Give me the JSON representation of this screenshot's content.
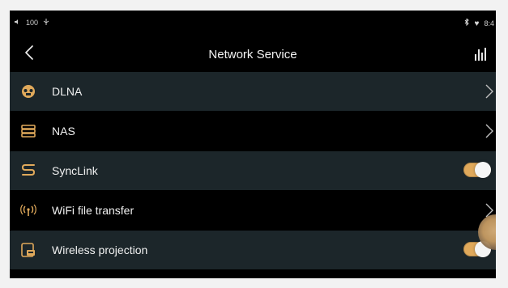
{
  "status": {
    "battery": "100",
    "time": "8:4"
  },
  "header": {
    "title": "Network Service"
  },
  "items": [
    {
      "label": "DLNA",
      "icon": "dlna-icon",
      "action": "chevron"
    },
    {
      "label": "NAS",
      "icon": "nas-icon",
      "action": "chevron"
    },
    {
      "label": "SyncLink",
      "icon": "synclink-icon",
      "action": "toggle",
      "on": true
    },
    {
      "label": "WiFi file transfer",
      "icon": "wifi-transfer-icon",
      "action": "chevron"
    },
    {
      "label": "Wireless projection",
      "icon": "projection-icon",
      "action": "toggle",
      "on": true
    }
  ],
  "colors": {
    "accent": "#e0a95b",
    "row_alt": "#1c262a",
    "background": "#000000"
  }
}
